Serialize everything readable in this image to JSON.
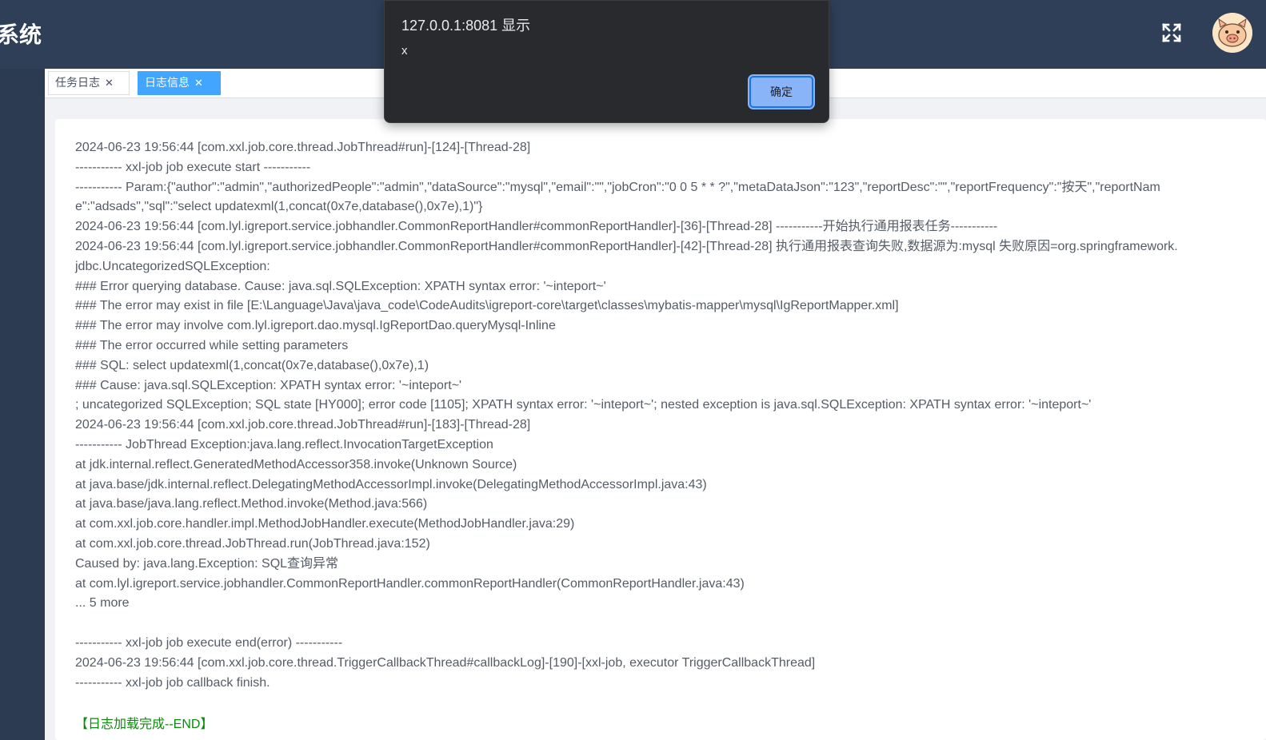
{
  "header": {
    "app_title": "系统",
    "fullscreen_icon": "fullscreen-icon",
    "avatar_icon": "pig-avatar"
  },
  "tabs": [
    {
      "label": "任务日志",
      "active": false
    },
    {
      "label": "日志信息",
      "active": true
    }
  ],
  "tab_close_glyph": "✕",
  "dialog": {
    "title": "127.0.0.1:8081 显示",
    "message": "x",
    "ok_label": "确定"
  },
  "log": {
    "lines": [
      "2024-06-23 19:56:44 [com.xxl.job.core.thread.JobThread#run]-[124]-[Thread-28]",
      "----------- xxl-job job execute start -----------",
      "----------- Param:{\"author\":\"admin\",\"authorizedPeople\":\"admin\",\"dataSource\":\"mysql\",\"email\":\"\",\"jobCron\":\"0 0 5 * * ?\",\"metaDataJson\":\"123\",\"reportDesc\":\"\",\"reportFrequency\":\"按天\",\"reportName\":\"adsads\",\"sql\":\"select updatexml(1,concat(0x7e,database(),0x7e),1)\"}",
      "2024-06-23 19:56:44 [com.lyl.igreport.service.jobhandler.CommonReportHandler#commonReportHandler]-[36]-[Thread-28] -----------开始执行通用报表任务-----------",
      "2024-06-23 19:56:44 [com.lyl.igreport.service.jobhandler.CommonReportHandler#commonReportHandler]-[42]-[Thread-28] 执行通用报表查询失败,数据源为:mysql 失败原因=org.springframework.jdbc.UncategorizedSQLException:",
      "### Error querying database. Cause: java.sql.SQLException: XPATH syntax error: '~inteport~'",
      "### The error may exist in file [E:\\Language\\Java\\java_code\\CodeAudits\\igreport-core\\target\\classes\\mybatis-mapper\\mysql\\IgReportMapper.xml]",
      "### The error may involve com.lyl.igreport.dao.mysql.IgReportDao.queryMysql-Inline",
      "### The error occurred while setting parameters",
      "### SQL: select updatexml(1,concat(0x7e,database(),0x7e),1)",
      "### Cause: java.sql.SQLException: XPATH syntax error: '~inteport~'",
      "; uncategorized SQLException; SQL state [HY000]; error code [1105]; XPATH syntax error: '~inteport~'; nested exception is java.sql.SQLException: XPATH syntax error: '~inteport~'",
      "2024-06-23 19:56:44 [com.xxl.job.core.thread.JobThread#run]-[183]-[Thread-28]",
      "----------- JobThread Exception:java.lang.reflect.InvocationTargetException",
      "at jdk.internal.reflect.GeneratedMethodAccessor358.invoke(Unknown Source)",
      "at java.base/jdk.internal.reflect.DelegatingMethodAccessorImpl.invoke(DelegatingMethodAccessorImpl.java:43)",
      "at java.base/java.lang.reflect.Method.invoke(Method.java:566)",
      "at com.xxl.job.core.handler.impl.MethodJobHandler.execute(MethodJobHandler.java:29)",
      "at com.xxl.job.core.thread.JobThread.run(JobThread.java:152)",
      "Caused by: java.lang.Exception: SQL查询异常",
      "at com.lyl.igreport.service.jobhandler.CommonReportHandler.commonReportHandler(CommonReportHandler.java:43)",
      "... 5 more",
      "",
      "----------- xxl-job job execute end(error) -----------",
      "2024-06-23 19:56:44 [com.xxl.job.core.thread.TriggerCallbackThread#callbackLog]-[190]-[xxl-job, executor TriggerCallbackThread]",
      "----------- xxl-job job callback finish."
    ],
    "end_marker": "【日志加载完成--END】",
    "end_color": "#0a8a0a"
  }
}
